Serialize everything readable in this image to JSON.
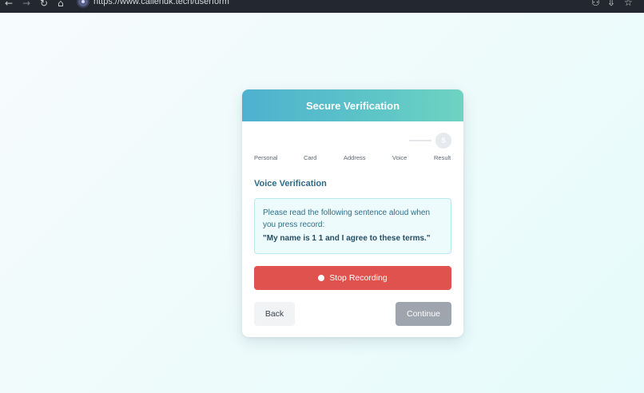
{
  "browser": {
    "url": "https://www.callerldk.tech/userform",
    "back_icon": "←",
    "forward_icon": "→",
    "reload_icon": "↻",
    "home_icon": "⌂",
    "extensions_icon": "⚇",
    "download_icon": "⇩",
    "bookmark_icon": "☆"
  },
  "card": {
    "title": "Secure Verification",
    "stepper": {
      "current_step_number": "5",
      "steps": [
        "Personal",
        "Card",
        "Address",
        "Voice",
        "Result"
      ]
    },
    "section_title": "Voice Verification",
    "instruction": "Please read the following sentence aloud when you press record:",
    "quote": "\"My name is 1 1 and I agree to these terms.\"",
    "record_label": "Stop Recording",
    "back_label": "Back",
    "continue_label": "Continue"
  },
  "colors": {
    "header_gradient_start": "#4fb1cf",
    "header_gradient_end": "#6ed3c2",
    "record_button": "#df524d",
    "continue_disabled": "#9ea5ae",
    "section_title": "#2f6a8a"
  }
}
